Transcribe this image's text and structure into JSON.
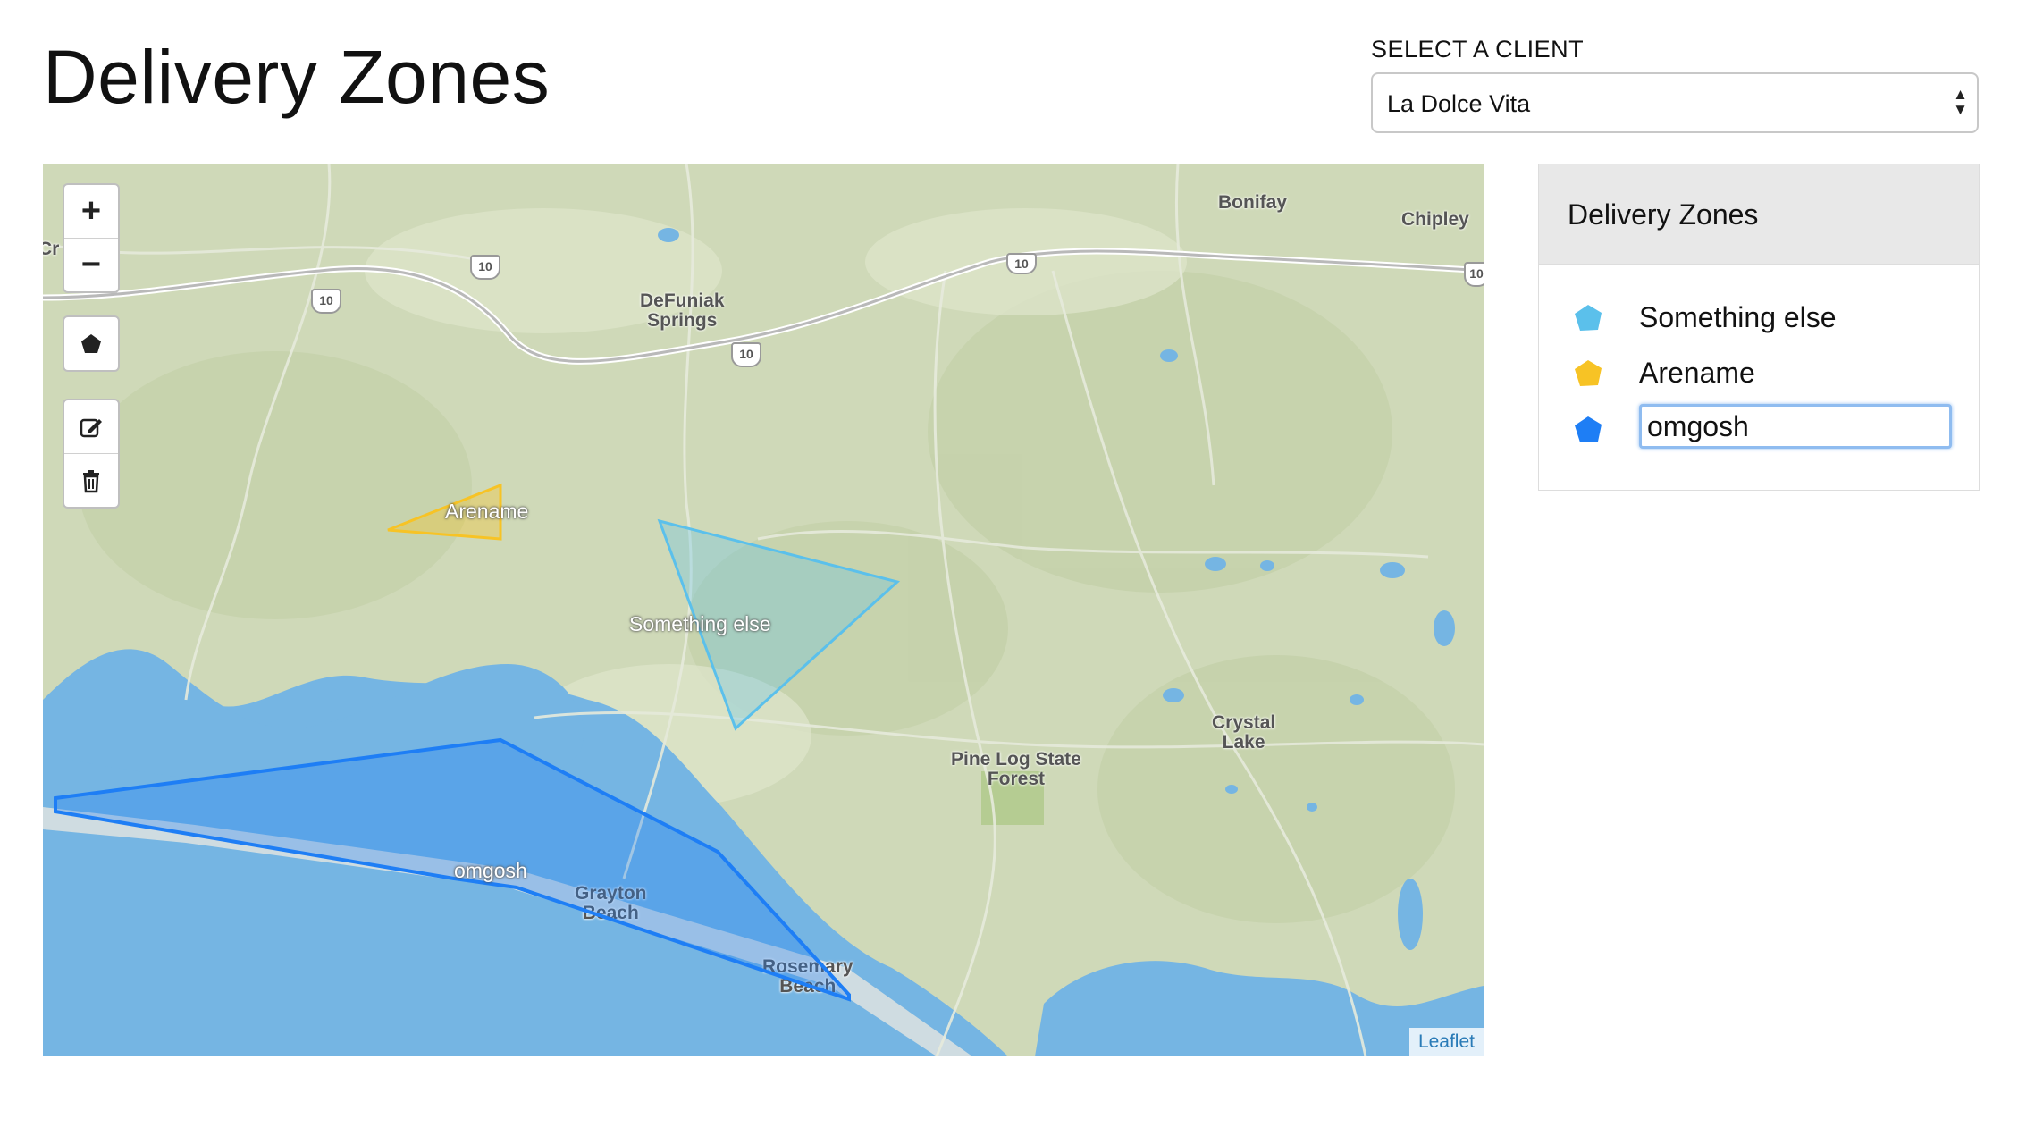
{
  "page": {
    "title": "Delivery Zones"
  },
  "client_selector": {
    "label": "SELECT A CLIENT",
    "selected": "La Dolce Vita"
  },
  "map": {
    "controls": {
      "zoom_in": "+",
      "zoom_out": "−"
    },
    "attribution": "Leaflet",
    "zone_labels": {
      "arename": "Arename",
      "something_else": "Something else",
      "omgosh": "omgosh"
    },
    "places": {
      "bonifay": "Bonifay",
      "chipley": "Chipley",
      "defuniak": "DeFuniak\nSprings",
      "crystal_lake": "Crystal\nLake",
      "pine_log": "Pine Log State\nForest",
      "grayton": "Grayton\nBeach",
      "rosemary": "Rosemary\nBeach",
      "crestview": "Cr    ew"
    },
    "highway_shields": [
      "10",
      "10",
      "10",
      "10",
      "10"
    ]
  },
  "zones_panel": {
    "header": "Delivery Zones",
    "zones": [
      {
        "name": "Something else",
        "color": "#5bc0eb"
      },
      {
        "name": "Arename",
        "color": "#f7c325"
      },
      {
        "name": "omgosh",
        "color": "#1e7ef5",
        "editing": true
      }
    ]
  },
  "colors": {
    "water": "#75b5e3",
    "land": "#cfd9b8",
    "zone_blue": "#1e7ef5",
    "zone_light_blue": "#5bc0eb",
    "zone_yellow": "#f7c325"
  }
}
